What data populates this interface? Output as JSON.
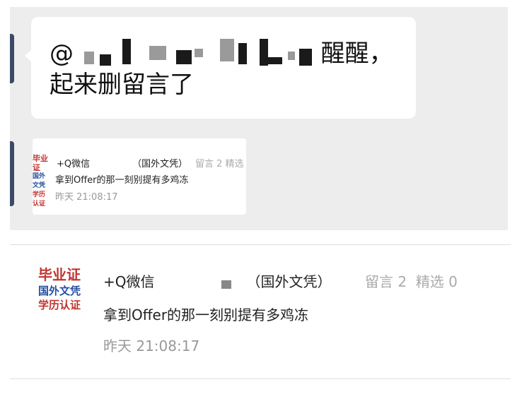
{
  "chat": {
    "bubble_prefix": "@",
    "bubble_line1_suffix": "醒醒，",
    "bubble_line2": "起来删留言了"
  },
  "shared_article": {
    "logo": {
      "line1": "毕业证",
      "line2": "国外文凭",
      "line3": "学历认证"
    },
    "title_prefix": "+Q微信",
    "title_suffix": "（国外文凭）",
    "comments": "留言 2",
    "selected": "精选 0",
    "small_selected": "精选",
    "body": "拿到Offer的那一刻别提有多鸡冻",
    "time": "昨天 21:08:17"
  },
  "colors": {
    "logo_red": "#c0342f",
    "logo_blue": "#234da0",
    "chat_bg": "#ededed"
  }
}
